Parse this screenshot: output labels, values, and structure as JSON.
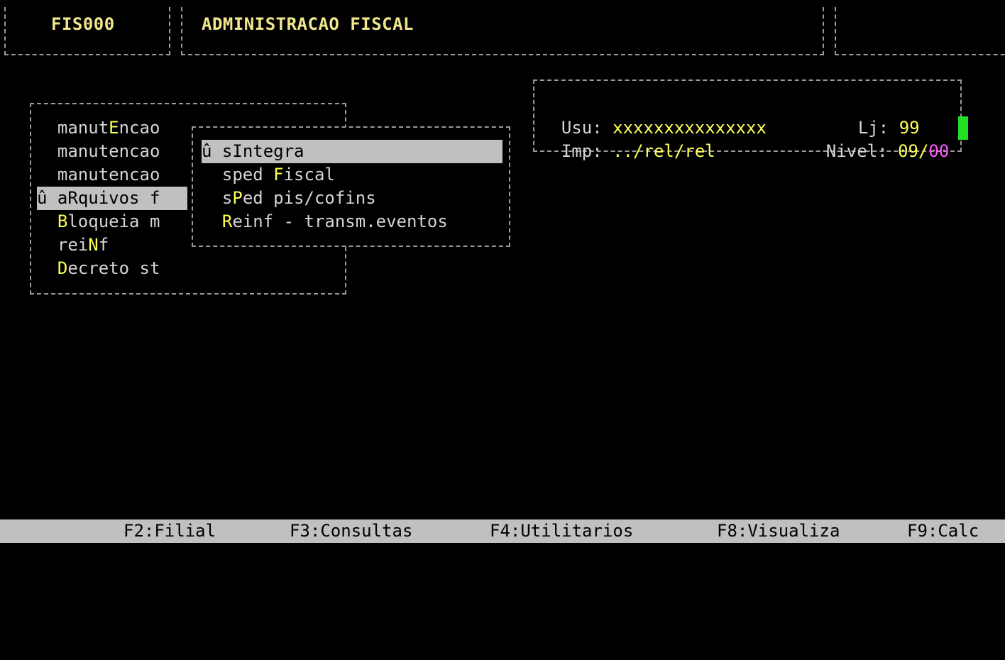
{
  "header": {
    "program_code": "FIS000",
    "program_title": "ADMINISTRACAO FISCAL",
    "right_box": ""
  },
  "info_box": {
    "usu_label": "Usu:",
    "usu_value": "xxxxxxxxxxxxxxx",
    "lj_label": "Lj:",
    "lj_value": "99",
    "imp_label": "Imp:",
    "imp_value": "../rel/rel",
    "nivel_label": "Nivel:",
    "nivel_value_a": "09/",
    "nivel_value_b": "00"
  },
  "main_menu": {
    "selected_marker": "û",
    "items": [
      {
        "pre": "manut",
        "hot": "E",
        "post": "ncao"
      },
      {
        "pre": "manutencao",
        "hot": "",
        "post": ""
      },
      {
        "pre": "manutencao",
        "hot": "",
        "post": ""
      },
      {
        "pre": "a",
        "hot": "R",
        "post": "quivos f"
      },
      {
        "pre": "",
        "hot": "B",
        "post": "loqueia m"
      },
      {
        "pre": "rei",
        "hot": "N",
        "post": "f"
      },
      {
        "pre": "",
        "hot": "D",
        "post": "ecreto st"
      }
    ]
  },
  "submenu": {
    "selected_marker": "û",
    "items": [
      {
        "pre": "s",
        "hot": "I",
        "post": "ntegra"
      },
      {
        "pre": "sped ",
        "hot": "F",
        "post": "iscal"
      },
      {
        "pre": "s",
        "hot": "P",
        "post": "ed pis/cofins"
      },
      {
        "pre": "",
        "hot": "R",
        "post": "einf - transm.eventos"
      }
    ]
  },
  "function_keys": [
    {
      "label": "F2:Filial"
    },
    {
      "label": "F3:Consultas"
    },
    {
      "label": "F4:Utilitarios"
    },
    {
      "label": "F8:Visualiza"
    },
    {
      "label": "F9:Calc"
    }
  ]
}
